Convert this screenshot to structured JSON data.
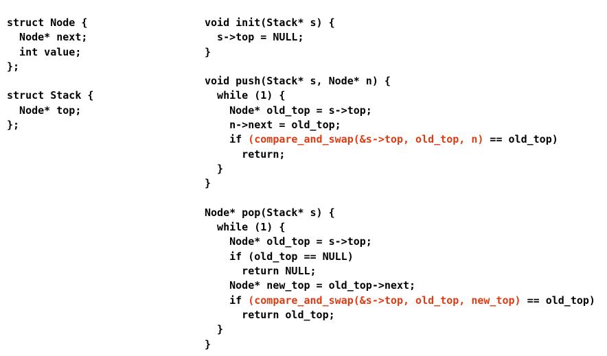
{
  "colors": {
    "background": "#ffffff",
    "text": "#000000",
    "highlight": "#dd3b11"
  },
  "code": {
    "language": "C",
    "left_column": {
      "name": "struct-definitions",
      "lines": [
        [
          {
            "t": "struct Node {",
            "c": "plain"
          }
        ],
        [
          {
            "t": "  Node* next;",
            "c": "plain"
          }
        ],
        [
          {
            "t": "  int value;",
            "c": "plain"
          }
        ],
        [
          {
            "t": "};",
            "c": "plain"
          }
        ],
        [
          {
            "t": "",
            "c": "plain"
          }
        ],
        [
          {
            "t": "struct Stack {",
            "c": "plain"
          }
        ],
        [
          {
            "t": "  Node* top;",
            "c": "plain"
          }
        ],
        [
          {
            "t": "};",
            "c": "plain"
          }
        ]
      ]
    },
    "right_column": {
      "name": "stack-operations",
      "lines": [
        [
          {
            "t": "void init(Stack* s) {",
            "c": "plain"
          }
        ],
        [
          {
            "t": "  s->top = NULL;",
            "c": "plain"
          }
        ],
        [
          {
            "t": "}",
            "c": "plain"
          }
        ],
        [
          {
            "t": "",
            "c": "plain"
          }
        ],
        [
          {
            "t": "void push(Stack* s, Node* n) {",
            "c": "plain"
          }
        ],
        [
          {
            "t": "  while (1) {",
            "c": "plain"
          }
        ],
        [
          {
            "t": "    Node* old_top = s->top;",
            "c": "plain"
          }
        ],
        [
          {
            "t": "    n->next = old_top;",
            "c": "plain"
          }
        ],
        [
          {
            "t": "    if ",
            "c": "plain"
          },
          {
            "t": "(compare_and_swap(&s->top, old_top, n)",
            "c": "cas"
          },
          {
            "t": " == old_top)",
            "c": "plain"
          }
        ],
        [
          {
            "t": "      return;",
            "c": "plain"
          }
        ],
        [
          {
            "t": "  }",
            "c": "plain"
          }
        ],
        [
          {
            "t": "}",
            "c": "plain"
          }
        ],
        [
          {
            "t": "",
            "c": "plain"
          }
        ],
        [
          {
            "t": "Node* pop(Stack* s) {",
            "c": "plain"
          }
        ],
        [
          {
            "t": "  while (1) {",
            "c": "plain"
          }
        ],
        [
          {
            "t": "    Node* old_top = s->top;",
            "c": "plain"
          }
        ],
        [
          {
            "t": "    if (old_top == NULL)",
            "c": "plain"
          }
        ],
        [
          {
            "t": "      return NULL;",
            "c": "plain"
          }
        ],
        [
          {
            "t": "    Node* new_top = old_top->next;",
            "c": "plain"
          }
        ],
        [
          {
            "t": "    if ",
            "c": "plain"
          },
          {
            "t": "(compare_and_swap(&s->top, old_top, new_top)",
            "c": "cas"
          },
          {
            "t": " == old_top)",
            "c": "plain"
          }
        ],
        [
          {
            "t": "      return old_top;",
            "c": "plain"
          }
        ],
        [
          {
            "t": "  }",
            "c": "plain"
          }
        ],
        [
          {
            "t": "}",
            "c": "plain"
          }
        ]
      ]
    }
  }
}
